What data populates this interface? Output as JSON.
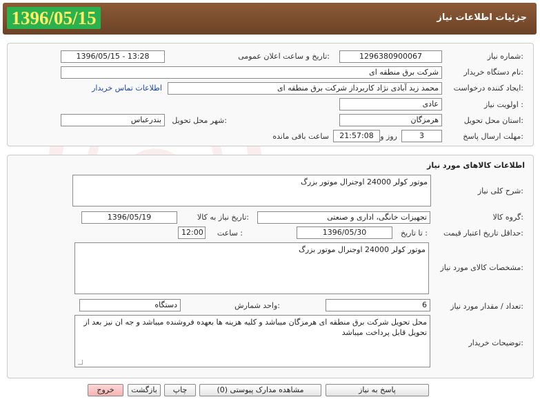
{
  "header": {
    "title": "جزئیات اطلاعات نیاز",
    "date_badge": "1396/05/15"
  },
  "info": {
    "need_number_label": "شماره نیاز:",
    "need_number": "1296380900067",
    "announce_label": "تاریخ و ساعت اعلان عمومی:",
    "announce_value": "1396/05/15 - 13:28",
    "buyer_label": "نام دستگاه خریدار:",
    "buyer_value": "شرکت برق منطقه ای",
    "creator_label": "ایجاد کننده درخواست:",
    "creator_value": "محمد زید آبادی نژاد کاربرداز شرکت برق منطقه ای",
    "contact_link": "اطلاعات تماس خریدار",
    "priority_label": "اولویت نیاز :",
    "priority_value": "عادی",
    "province_label": "استان محل تحویل:",
    "province_value": "هرمزگان",
    "city_label": "شهر محل تحویل:",
    "city_value": "بندرعباس",
    "deadline_label": "مهلت ارسال پاسخ:",
    "days_value": "3",
    "days_unit": "روز و",
    "time_value": "21:57:08",
    "remaining_label": "ساعت باقی مانده"
  },
  "goods": {
    "section_title": "اطلاعات کالاهای مورد نیاز",
    "summary_label": "شرح کلی نیاز:",
    "summary_value": "موتور کولر 24000 اوجنرال موتور بزرگ",
    "group_label": "گروه کالا:",
    "group_value": "تجهیزات خانگی، اداری و صنعتی",
    "need_date_label": "تاریخ نیاز به کالا:",
    "need_date_value": "1396/05/19",
    "validity_label": "حداقل تاریخ اعتبار قیمت:",
    "validity_until_label": "تا تاریخ :",
    "validity_date": "1396/05/30",
    "time_label": "ساعت :",
    "time_value": "12:00",
    "spec_label": "مشخصات کالای مورد نیاز:",
    "spec_value": "موتور کولر 24000 اوجنرال موتور بزرگ",
    "qty_label": "تعداد / مقدار مورد نیاز:",
    "qty_value": "6",
    "unit_label": "واحد شمارش:",
    "unit_value": "دستگاه",
    "notes_label": "توضیحات خریدار:",
    "notes_value": "محل تحویل شرکت برق منطقه ای هرمزگان میباشد و کلیه هزینه ها بعهده فروشنده میباشد  و جه ان نیز بعد از تحویل قابل پرداخت میباشد"
  },
  "buttons": {
    "reply": "پاسخ به نیاز",
    "attachments": "مشاهده مدارک پیوستی (0)",
    "print": "چاپ",
    "back": "بازگشت",
    "exit": "خروج"
  },
  "colors": {
    "header_bg": "#7a4d2e",
    "badge_bg": "#2bb14d",
    "badge_text": "#ffee66",
    "link": "#1a44b8",
    "exit_btn": "#f4b4b4"
  }
}
